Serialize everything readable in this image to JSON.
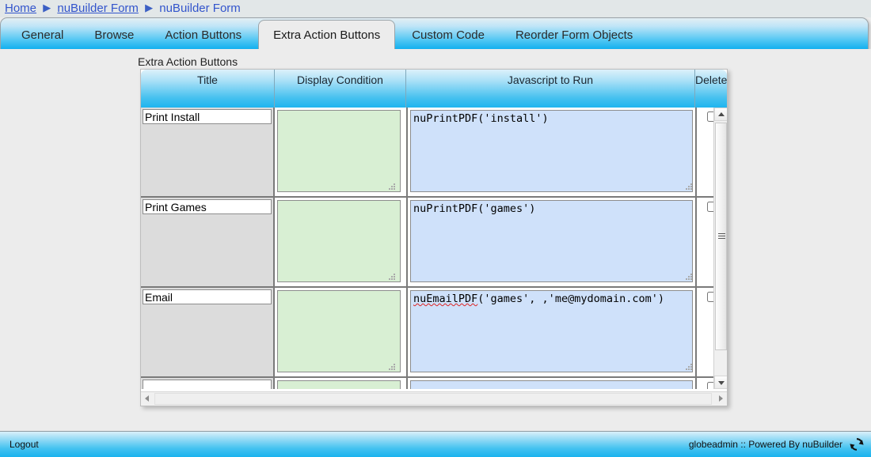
{
  "breadcrumb": {
    "items": [
      {
        "label": "Home",
        "link": true
      },
      {
        "label": "nuBuilder Form",
        "link": true
      },
      {
        "label": "nuBuilder Form",
        "link": false
      }
    ],
    "separator": "▶"
  },
  "tabs": [
    {
      "label": "General",
      "active": false
    },
    {
      "label": "Browse",
      "active": false
    },
    {
      "label": "Action Buttons",
      "active": false
    },
    {
      "label": "Extra Action Buttons",
      "active": true
    },
    {
      "label": "Custom Code",
      "active": false
    },
    {
      "label": "Reorder Form Objects",
      "active": false
    }
  ],
  "section": {
    "label": "Extra Action Buttons"
  },
  "grid": {
    "columns": [
      "Title",
      "Display Condition",
      "Javascript to Run",
      "Delete"
    ],
    "rows": [
      {
        "title": "Print Install",
        "display_condition": "",
        "javascript": "nuPrintPDF('install')",
        "javascript_spellword": "",
        "javascript_rest": "nuPrintPDF('install')",
        "delete_checked": false
      },
      {
        "title": "Print Games",
        "display_condition": "",
        "javascript": "nuPrintPDF('games')",
        "javascript_spellword": "",
        "javascript_rest": "nuPrintPDF('games')",
        "delete_checked": false
      },
      {
        "title": "Email",
        "display_condition": "",
        "javascript": "nuEmailPDF('games', ,'me@mydomain.com')",
        "javascript_spellword": "nuEmailPDF",
        "javascript_rest": "('games', ,'me@mydomain.com')",
        "delete_checked": false
      },
      {
        "title": "",
        "display_condition": "",
        "javascript": "",
        "javascript_spellword": "",
        "javascript_rest": "",
        "delete_checked": false
      }
    ],
    "title_placeholder": "",
    "condition_placeholder": "",
    "javascript_placeholder": ""
  },
  "footer": {
    "logout": "Logout",
    "status": "globeadmin :: Powered By nuBuilder"
  },
  "colors": {
    "accent_blue": "#19b2ee",
    "header_gradient_top": "#ddf1fa",
    "condition_bg": "#d8efd3",
    "javascript_bg": "#cfe1fa",
    "title_cell_bg": "#dcdcdc",
    "page_bg": "#ececec",
    "link": "#3355cc",
    "spellcheck_underline": "#dd2222"
  }
}
